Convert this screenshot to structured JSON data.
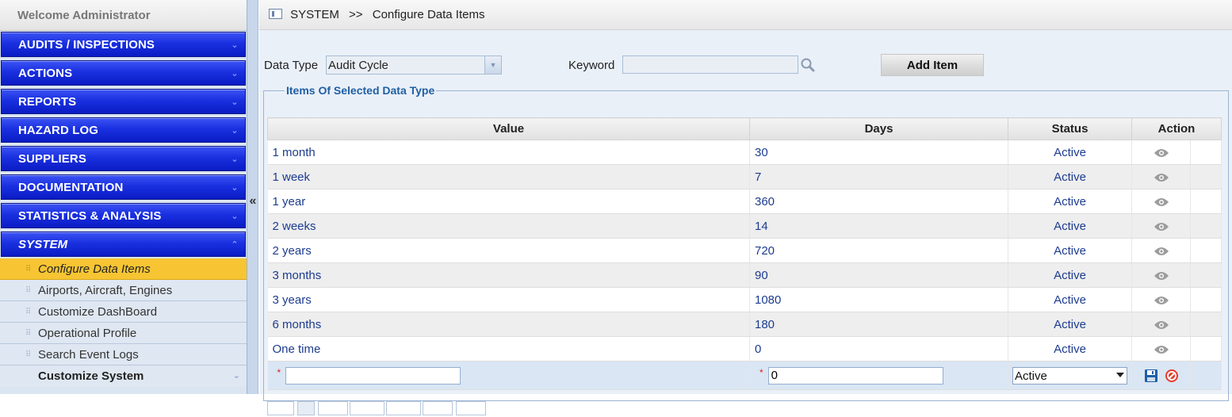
{
  "sidebar": {
    "welcome": "Welcome  Administrator",
    "nav": [
      {
        "label": "AUDITS / INSPECTIONS"
      },
      {
        "label": "ACTIONS"
      },
      {
        "label": "REPORTS"
      },
      {
        "label": "HAZARD LOG"
      },
      {
        "label": "SUPPLIERS"
      },
      {
        "label": "DOCUMENTATION"
      },
      {
        "label": "STATISTICS & ANALYSIS"
      },
      {
        "label": "SYSTEM"
      }
    ],
    "sub_items": [
      {
        "label": "Configure Data Items"
      },
      {
        "label": "Airports, Aircraft, Engines"
      },
      {
        "label": "Customize DashBoard"
      },
      {
        "label": "Operational Profile"
      },
      {
        "label": "Search Event Logs"
      },
      {
        "label": "Customize System"
      }
    ],
    "chevron_down": "⌄",
    "chevron_up": "⌃",
    "collapse_glyph": "«"
  },
  "breadcrumb": {
    "section": "SYSTEM",
    "separator": ">>",
    "page": "Configure Data Items"
  },
  "filters": {
    "data_type_label": "Data Type",
    "data_type_value": "Audit Cycle",
    "keyword_label": "Keyword",
    "keyword_value": "",
    "add_item_label": "Add Item"
  },
  "items": {
    "legend": "Items Of Selected Data Type",
    "columns": {
      "value": "Value",
      "days": "Days",
      "status": "Status",
      "action": "Action"
    },
    "rows": [
      {
        "value": "1 month",
        "days": "30",
        "status": "Active"
      },
      {
        "value": "1 week",
        "days": "7",
        "status": "Active"
      },
      {
        "value": "1 year",
        "days": "360",
        "status": "Active"
      },
      {
        "value": "2 weeks",
        "days": "14",
        "status": "Active"
      },
      {
        "value": "2 years",
        "days": "720",
        "status": "Active"
      },
      {
        "value": "3 months",
        "days": "90",
        "status": "Active"
      },
      {
        "value": "3 years",
        "days": "1080",
        "status": "Active"
      },
      {
        "value": "6 months",
        "days": "180",
        "status": "Active"
      },
      {
        "value": "One time",
        "days": "0",
        "status": "Active"
      }
    ],
    "new_row": {
      "required_mark": "*",
      "value": "",
      "days": "0",
      "status": "Active"
    }
  },
  "colors": {
    "nav_blue": "#1a30e0",
    "highlight": "#f7c533",
    "link_text": "#1d3c8f",
    "legend_text": "#1f5fa4",
    "cancel_red": "#e53b2c",
    "save_blue": "#1f5fa8"
  },
  "icons": {
    "breadcrumb": "panel-icon",
    "search": "magnifier-icon",
    "view": "eye-icon",
    "save": "floppy-disk-icon",
    "cancel": "cancel-icon"
  }
}
